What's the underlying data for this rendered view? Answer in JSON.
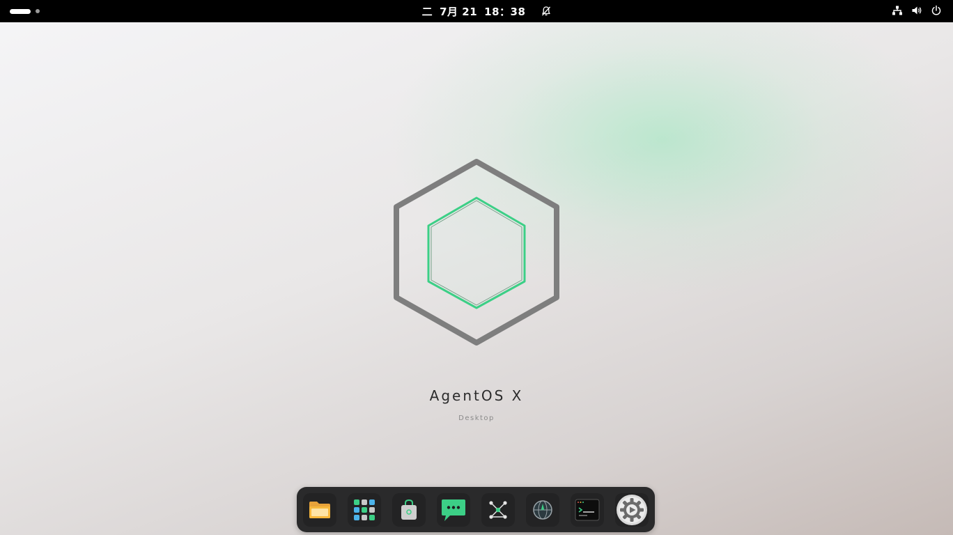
{
  "topbar": {
    "clock": {
      "weekday": "二",
      "date": "7月 21",
      "time": "18：38"
    },
    "icons": [
      "workspace-indicator",
      "notifications-muted-icon",
      "network-icon",
      "volume-icon",
      "power-icon"
    ]
  },
  "desktop": {
    "brand_title": "AgentOS X",
    "brand_subtitle": "Desktop",
    "colors": {
      "accent": "#3ccf86",
      "logo_outer": "#7e7e7e",
      "topbar": "#000000",
      "dock": "#2a2a2b"
    }
  },
  "dock": {
    "apps": [
      {
        "name": "files",
        "icon": "folder-icon"
      },
      {
        "name": "app-grid",
        "icon": "app-grid-icon"
      },
      {
        "name": "software-store",
        "icon": "shopping-bag-icon"
      },
      {
        "name": "messages",
        "icon": "chat-bubble-icon"
      },
      {
        "name": "network-graph",
        "icon": "graph-nodes-icon"
      },
      {
        "name": "browser",
        "icon": "globe-icon"
      },
      {
        "name": "terminal",
        "icon": "terminal-icon"
      },
      {
        "name": "settings",
        "icon": "gear-icon"
      }
    ]
  }
}
